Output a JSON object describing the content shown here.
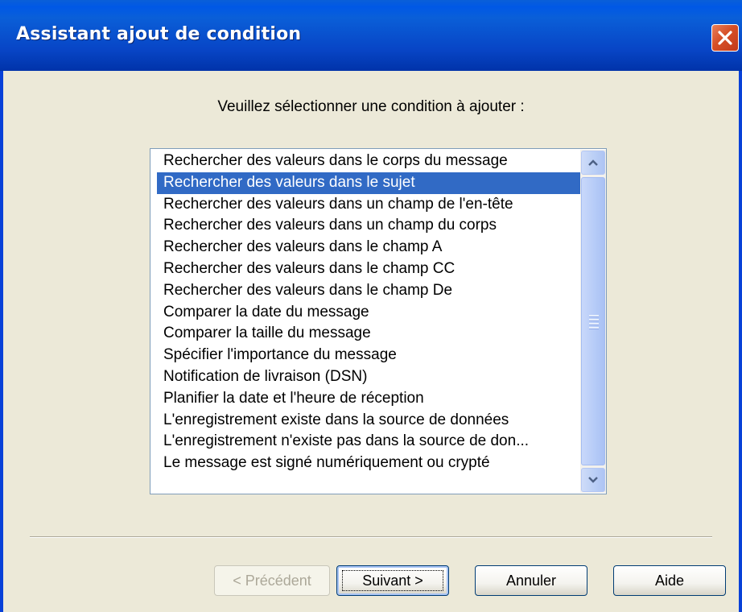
{
  "window": {
    "title": "Assistant ajout de condition"
  },
  "prompt": "Veuillez sélectionner une condition à ajouter :",
  "conditions": [
    {
      "label": "Rechercher des valeurs dans le corps du message",
      "selected": false
    },
    {
      "label": "Rechercher des valeurs dans le sujet",
      "selected": true
    },
    {
      "label": "Rechercher des valeurs dans un champ de l'en-tête",
      "selected": false
    },
    {
      "label": "Rechercher des valeurs dans un champ du corps",
      "selected": false
    },
    {
      "label": "Rechercher des valeurs dans le champ A",
      "selected": false
    },
    {
      "label": "Rechercher des valeurs dans le champ CC",
      "selected": false
    },
    {
      "label": "Rechercher des valeurs dans le champ De",
      "selected": false
    },
    {
      "label": "Comparer la date du message",
      "selected": false
    },
    {
      "label": "Comparer la taille du message",
      "selected": false
    },
    {
      "label": "Spécifier l'importance du message",
      "selected": false
    },
    {
      "label": "Notification de livraison (DSN)",
      "selected": false
    },
    {
      "label": "Planifier la date et l'heure de réception",
      "selected": false
    },
    {
      "label": "L'enregistrement existe dans la source de données",
      "selected": false
    },
    {
      "label": "L'enregistrement n'existe pas dans la source de don...",
      "selected": false
    },
    {
      "label": "Le message est signé numériquement ou crypté",
      "selected": false
    }
  ],
  "buttons": {
    "previous": "< Précédent",
    "next": "Suivant >",
    "cancel": "Annuler",
    "help": "Aide"
  },
  "colors": {
    "titlebar": "#0a5fd8",
    "selection": "#316ac5",
    "dialog_bg": "#ece9d8"
  }
}
